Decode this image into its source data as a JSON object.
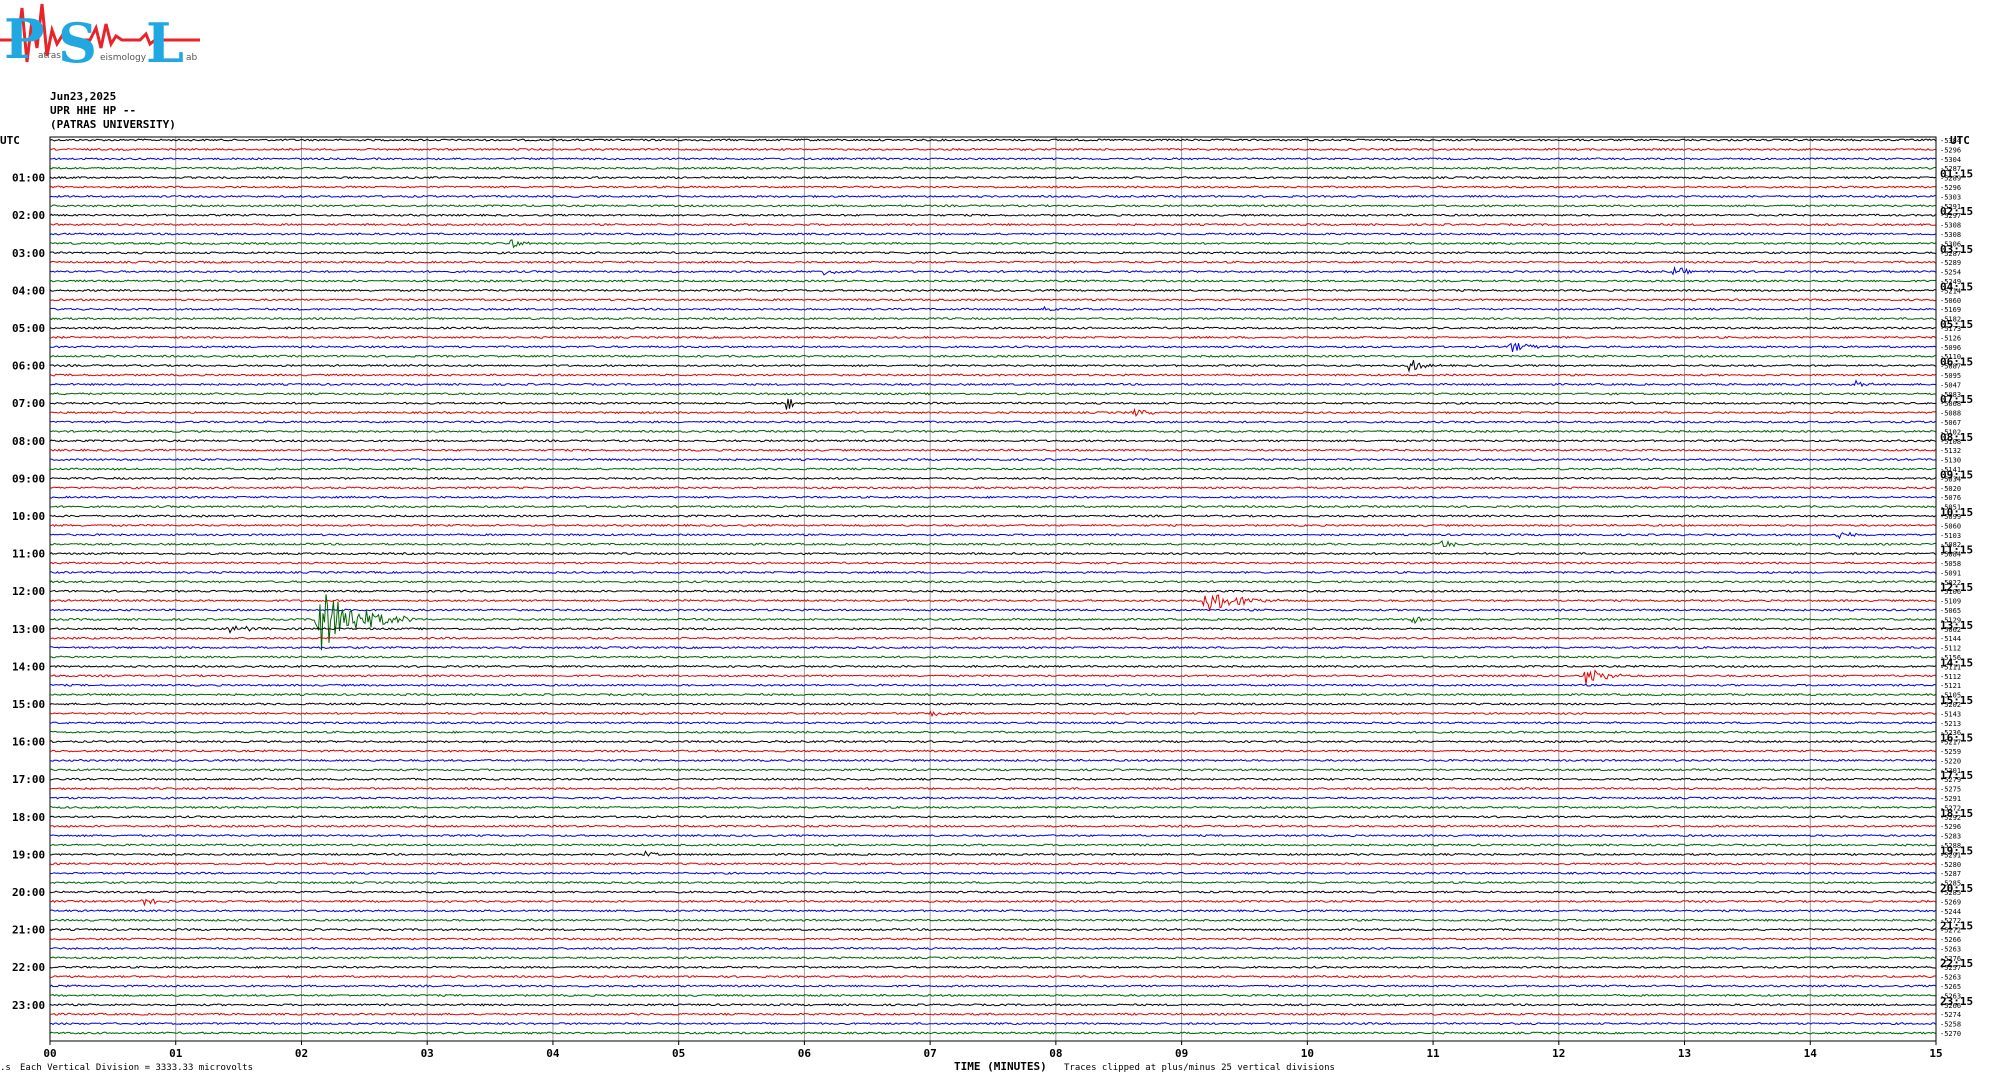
{
  "logo": {
    "letters": [
      "P",
      "S",
      "L"
    ],
    "small_text": [
      "atras",
      "eismology",
      "ab"
    ],
    "colors": {
      "letters": "#22a8e0",
      "wave": "#e8232a"
    }
  },
  "header": {
    "date": "Jun23,2025",
    "station": "UPR HHE HP --",
    "institution": "(PATRAS UNIVERSITY)"
  },
  "chart_data": {
    "type": "line",
    "title": "",
    "xlabel": "TIME (MINUTES)",
    "ylabel": "",
    "xlim": [
      0,
      15
    ],
    "x_ticks": [
      "00",
      "01",
      "02",
      "03",
      "04",
      "05",
      "06",
      "07",
      "08",
      "09",
      "10",
      "11",
      "12",
      "13",
      "14",
      "15"
    ],
    "utc_label": "UTC",
    "left_hour_labels": [
      "01:00",
      "02:00",
      "03:00",
      "04:00",
      "05:00",
      "06:00",
      "07:00",
      "08:00",
      "09:00",
      "10:00",
      "11:00",
      "12:00",
      "13:00",
      "14:00",
      "15:00",
      "16:00",
      "17:00",
      "18:00",
      "19:00",
      "20:00",
      "21:00",
      "22:00",
      "23:00"
    ],
    "right_hour_labels": [
      "01:15",
      "02:15",
      "03:15",
      "04:15",
      "05:15",
      "06:15",
      "07:15",
      "08:15",
      "09:15",
      "10:15",
      "11:15",
      "12:15",
      "13:15",
      "14:15",
      "15:15",
      "16:15",
      "17:15",
      "18:15",
      "19:15",
      "20:15",
      "21:15",
      "22:15",
      "23:15"
    ],
    "trace_offsets": [
      "-5384",
      "-5296",
      "-5304",
      "-5287",
      "-5289",
      "-5296",
      "-5303",
      "-5291",
      "-5297",
      "-5308",
      "-5308",
      "-5306",
      "-5287",
      "-5289",
      "-5254",
      "-5249",
      "-5214",
      "-5060",
      "-5169",
      "-5182",
      "-5173",
      "-5126",
      "-5096",
      "-5110",
      "-5087",
      "-5095",
      "-5047",
      "-5083",
      "-5068",
      "-5088",
      "-5067",
      "-5102",
      "-5108",
      "-5132",
      "-5130",
      "-5141",
      "-5034",
      "-5020",
      "-5076",
      "-5051",
      "-5099",
      "-5060",
      "-5103",
      "-5082",
      "-5084",
      "-5058",
      "-5091",
      "-5022",
      "-5106",
      "-5109",
      "-5065",
      "-5129",
      "-5062",
      "-5144",
      "-5112",
      "-5156",
      "-5111",
      "-5112",
      "-5121",
      "-5105",
      "-5202",
      "-5143",
      "-5213",
      "-5236",
      "-5217",
      "-5259",
      "-5220",
      "-5301",
      "-5279",
      "-5275",
      "-5291",
      "-5272",
      "-5292",
      "-5296",
      "-5283",
      "-5288",
      "-5291",
      "-5280",
      "-5287",
      "-5285",
      "-5285",
      "-5269",
      "-5244",
      "-5272",
      "-5272",
      "-5266",
      "-5263",
      "-5276",
      "-5257",
      "-5263",
      "-5265",
      "-5263",
      "-5266",
      "-5274",
      "-5258",
      "-5270"
    ],
    "trace_colors": [
      "#000000",
      "#e00000",
      "#0000e0",
      "#006400"
    ],
    "minutes_per_trace": 15,
    "events": [
      {
        "hour": 12.75,
        "minute": 2.1,
        "amplitude": 3.5,
        "duration": 0.8
      },
      {
        "hour": 12.25,
        "minute": 9.15,
        "amplitude": 1.2,
        "duration": 0.7
      },
      {
        "hour": 14.25,
        "minute": 12.2,
        "amplitude": 1.0,
        "duration": 0.4
      },
      {
        "hour": 6.0,
        "minute": 10.8,
        "amplitude": 0.7,
        "duration": 0.3
      },
      {
        "hour": 7.0,
        "minute": 5.85,
        "amplitude": 0.9,
        "duration": 0.15
      },
      {
        "hour": 5.5,
        "minute": 11.6,
        "amplitude": 0.6,
        "duration": 0.4
      },
      {
        "hour": 3.5,
        "minute": 6.15,
        "amplitude": 0.5,
        "duration": 0.3
      },
      {
        "hour": 3.5,
        "minute": 12.9,
        "amplitude": 0.5,
        "duration": 0.3
      },
      {
        "hour": 2.75,
        "minute": 3.65,
        "amplitude": 0.5,
        "duration": 0.25
      },
      {
        "hour": 4.5,
        "minute": 7.9,
        "amplitude": 0.5,
        "duration": 0.25
      },
      {
        "hour": 6.5,
        "minute": 14.35,
        "amplitude": 0.4,
        "duration": 0.2
      },
      {
        "hour": 10.5,
        "minute": 14.2,
        "amplitude": 0.5,
        "duration": 0.25
      },
      {
        "hour": 10.75,
        "minute": 11.05,
        "amplitude": 0.5,
        "duration": 0.25
      },
      {
        "hour": 12.75,
        "minute": 10.8,
        "amplitude": 0.5,
        "duration": 0.3
      },
      {
        "hour": 20.25,
        "minute": 0.7,
        "amplitude": 0.5,
        "duration": 0.3
      },
      {
        "hour": 17.25,
        "minute": 1.2,
        "amplitude": 0.4,
        "duration": 0.3
      },
      {
        "hour": 19.0,
        "minute": 4.7,
        "amplitude": 0.3,
        "duration": 0.3
      },
      {
        "hour": 13.0,
        "minute": 1.4,
        "amplitude": 0.4,
        "duration": 0.5
      },
      {
        "hour": 15.25,
        "minute": 7.0,
        "amplitude": 0.4,
        "duration": 0.25
      },
      {
        "hour": 7.25,
        "minute": 8.6,
        "amplitude": 0.4,
        "duration": 0.3
      }
    ]
  },
  "footer": {
    "scale": "Each Vertical Division = 3333.33 microvolts",
    "clip": "Traces clipped at plus/minus 25 vertical divisions"
  }
}
